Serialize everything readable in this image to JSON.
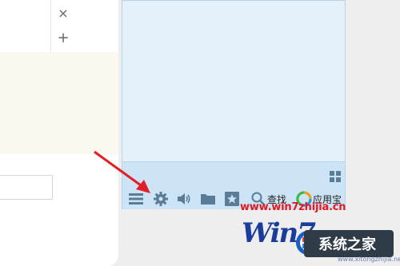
{
  "left_window": {
    "close_glyph": "×",
    "add_glyph": "+"
  },
  "start_panel": {
    "toolbar": {
      "items": [
        {
          "name": "all-programs",
          "icon": "menu-icon"
        },
        {
          "name": "settings",
          "icon": "gear-icon"
        },
        {
          "name": "volume",
          "icon": "speaker-icon"
        },
        {
          "name": "folder",
          "icon": "folder-icon"
        },
        {
          "name": "favorites",
          "icon": "star-icon"
        },
        {
          "name": "search",
          "icon": "search-icon",
          "label": "查找"
        },
        {
          "name": "app-store",
          "icon": "app-store-icon",
          "label": "应用宝"
        }
      ]
    },
    "tile_toggle_icon": "grid-icon",
    "colors": {
      "panel": "#e4f1fb",
      "footer": "#cce4f5",
      "icon": "#5a7c97"
    }
  },
  "watermark": {
    "url": "www.win7zhijia.cn",
    "logo_text": "Win7",
    "site": "系统之家",
    "site_url": "www.xitongzhijia.net"
  },
  "colors": {
    "arrow": "#e21f26"
  }
}
